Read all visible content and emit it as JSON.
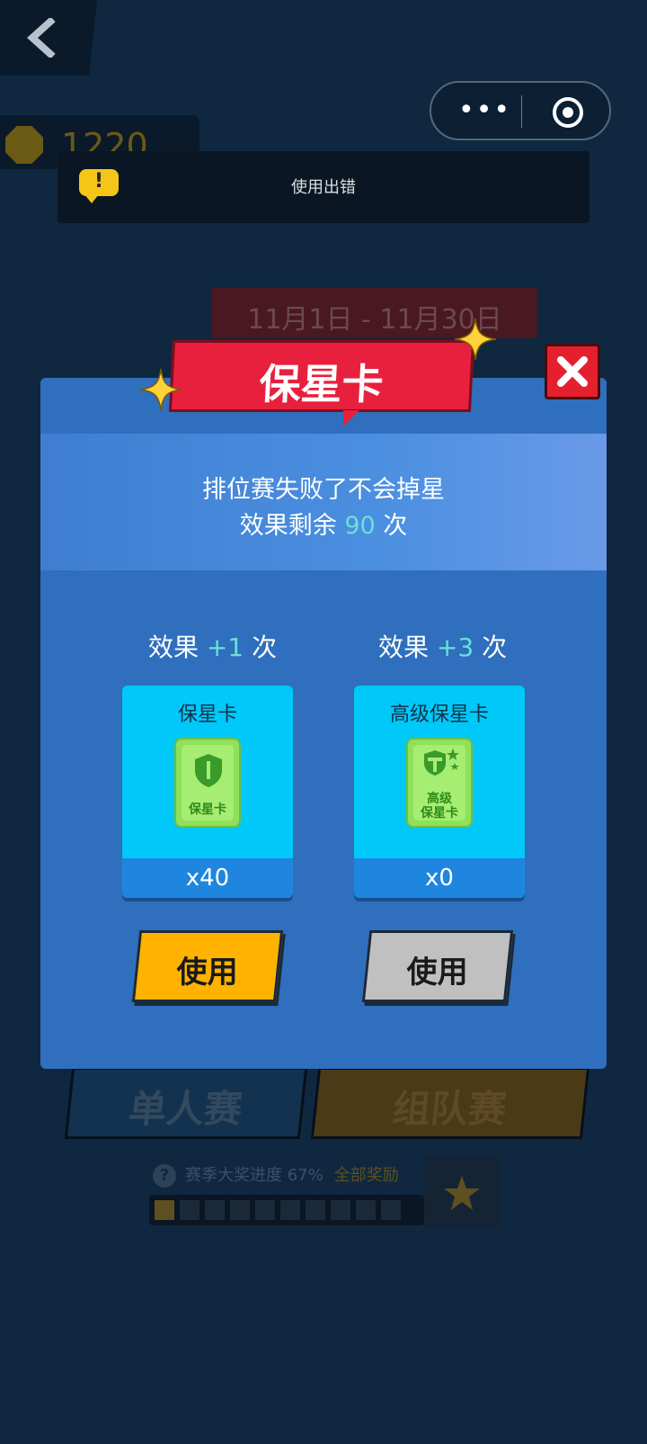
{
  "colors": {
    "background": "#0f2840",
    "panel": "#2f6fbd",
    "ribbon": "#e8203e",
    "accent_teal": "#6ae0d8",
    "use_active": "#ffb300",
    "use_disabled": "#c0c0c0"
  },
  "header": {
    "back_icon": "chevron-left-icon",
    "menu_icon": "more-dots-icon",
    "target_icon": "target-icon",
    "menu_dots": "•••"
  },
  "coins": {
    "value": "1220"
  },
  "toast": {
    "icon": "exclamation-bubble-icon",
    "icon_text": "!",
    "text": "使用出错"
  },
  "season": {
    "date_range": "11月1日 - 11月30日"
  },
  "background_buttons": {
    "single": "单人赛",
    "team": "组队赛"
  },
  "progress": {
    "label": "赛季大奖进度 67%",
    "all_rewards": "全部奖励",
    "help_icon": "?",
    "fraction": 0.67
  },
  "dialog": {
    "title": "保星卡",
    "description": "排位赛失败了不会掉星",
    "remaining_prefix": "效果剩余",
    "remaining_value": "90",
    "remaining_suffix": "次",
    "close_icon": "close-x-icon",
    "cards": [
      {
        "effect_prefix": "效果",
        "effect_value": "+1",
        "effect_suffix": "次",
        "name": "保星卡",
        "img_label": "保星卡",
        "count": "x40",
        "button": "使用"
      },
      {
        "effect_prefix": "效果",
        "effect_value": "+3",
        "effect_suffix": "次",
        "name": "高级保星卡",
        "img_label1": "高级",
        "img_label2": "保星卡",
        "count": "x0",
        "button": "使用"
      }
    ]
  }
}
